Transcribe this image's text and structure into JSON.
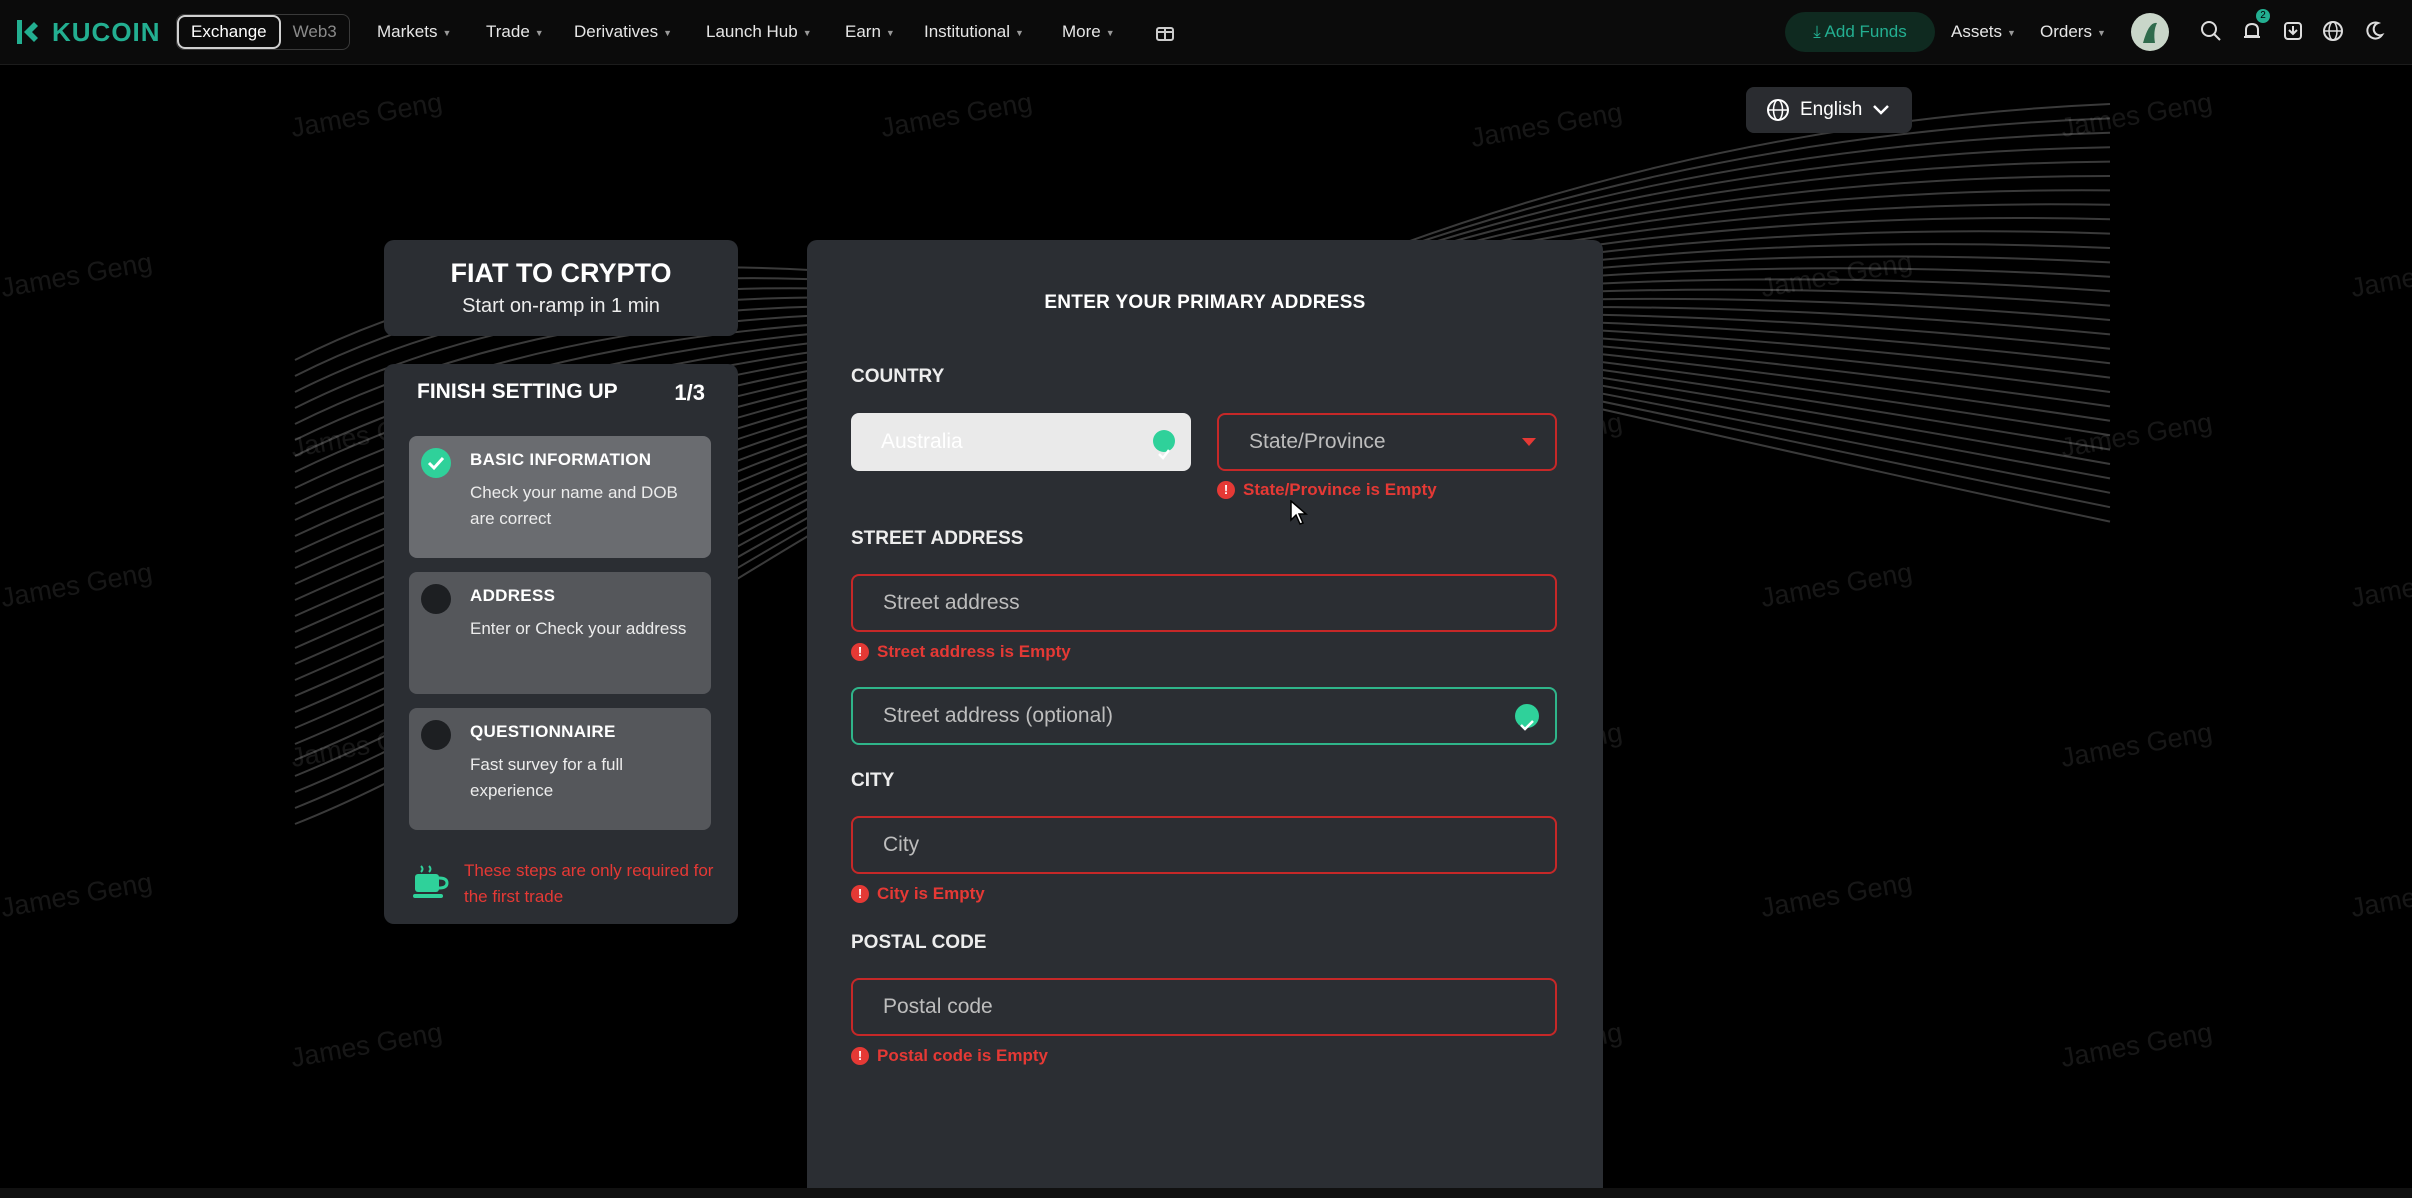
{
  "nav": {
    "logo_text": "KUCOIN",
    "switch": [
      "Exchange",
      "Web3"
    ],
    "menu": [
      "Markets",
      "Trade",
      "Derivatives",
      "Launch Hub",
      "Earn",
      "Institutional",
      "More"
    ],
    "add_funds": "Add Funds",
    "assets": "Assets",
    "orders": "Orders",
    "notification_count": "2"
  },
  "language": "English",
  "watermark": "James Geng",
  "left": {
    "title": "FIAT TO CRYPTO",
    "subtitle": "Start on-ramp in 1 min",
    "setup_heading": "FINISH SETTING UP",
    "setup_count": "1/3",
    "steps": [
      {
        "title": "BASIC INFORMATION",
        "desc": "Check your name and DOB are correct",
        "done": true
      },
      {
        "title": "ADDRESS",
        "desc": "Enter or Check your address",
        "done": false
      },
      {
        "title": "QUESTIONNAIRE",
        "desc": "Fast survey for a full experience",
        "done": false
      }
    ],
    "note": "These steps are only required for the first trade"
  },
  "form": {
    "title": "ENTER YOUR PRIMARY ADDRESS",
    "country_label": "COUNTRY",
    "country_value": "Australia",
    "state_placeholder": "State/Province",
    "state_error": "State/Province is Empty",
    "street_label": "STREET ADDRESS",
    "street_placeholder": "Street address",
    "street_error": "Street address is Empty",
    "street2_placeholder": "Street address (optional)",
    "city_label": "CITY",
    "city_placeholder": "City",
    "city_error": "City is Empty",
    "postal_label": "POSTAL CODE",
    "postal_placeholder": "Postal code",
    "postal_error": "Postal code is Empty"
  },
  "colors": {
    "accent": "#23af91",
    "error": "#e53935",
    "panel": "#2b2e33"
  }
}
